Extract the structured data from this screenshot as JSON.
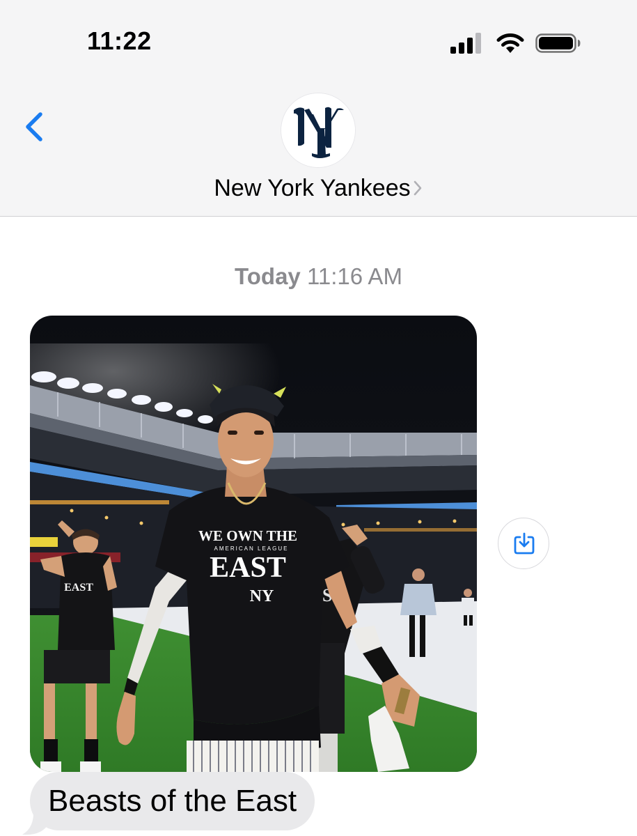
{
  "status_bar": {
    "time": "11:22",
    "icons": [
      "signal-icon",
      "wifi-icon",
      "battery-icon"
    ]
  },
  "nav": {
    "back_icon": "chevron-left-icon",
    "contact_name": "New York Yankees",
    "contact_chevron_icon": "chevron-right-icon",
    "avatar_logo": "NY",
    "avatar_logo_color": "#0c2340"
  },
  "conversation": {
    "timestamp_day": "Today",
    "timestamp_time": "11:16 AM",
    "messages": [
      {
        "type": "photo",
        "description_shirt_lines": [
          "WE OWN THE",
          "AMERICAN LEAGUE",
          "EAST"
        ],
        "shirt_logo": "NY",
        "action_icon": "save-download-icon"
      },
      {
        "type": "text",
        "text": "Beasts of the East"
      }
    ]
  },
  "colors": {
    "accent": "#1a7cf0",
    "header_bg": "#f5f5f6",
    "bubble_received": "#e9e9eb",
    "timestamp_gray": "#8a8a8e"
  }
}
